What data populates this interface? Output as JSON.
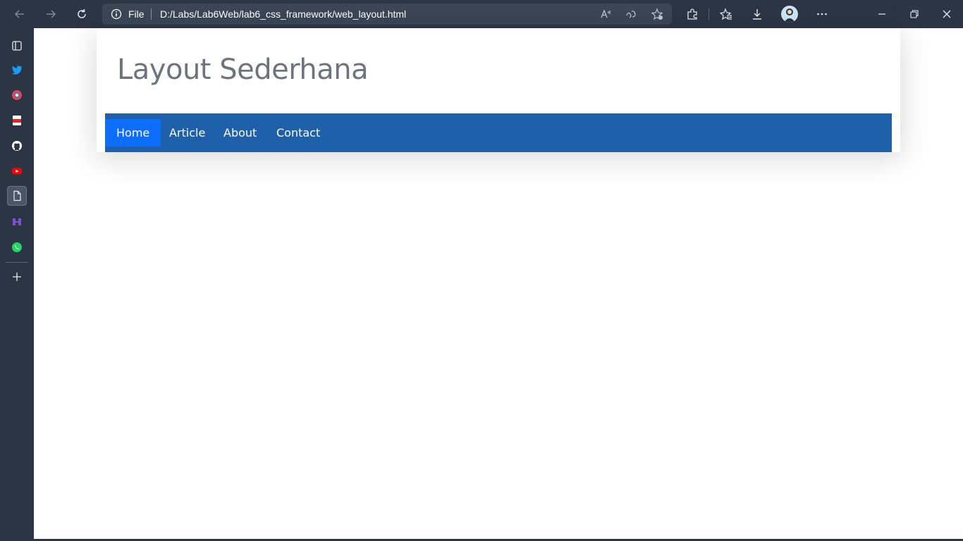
{
  "browser": {
    "address": {
      "scheme_label": "File",
      "url": "D:/Labs/Lab6Web/lab6_css_framework/web_layout.html"
    },
    "icons": {
      "back": "arrow-left-icon",
      "forward": "arrow-right-icon",
      "refresh": "refresh-icon",
      "info": "info-icon",
      "read_aloud": "read-aloud-icon",
      "translate": "translate-icon",
      "favorite_add": "star-add-icon",
      "extensions": "puzzle-icon",
      "favorites": "favorites-icon",
      "downloads": "download-icon",
      "profile": "avatar",
      "more": "more-icon",
      "minimize": "minimize-icon",
      "restore": "restore-icon",
      "close": "close-icon"
    }
  },
  "sidebar": {
    "items": [
      {
        "name": "tab-actions-icon"
      },
      {
        "name": "twitter-icon",
        "color": "#1d9bf0"
      },
      {
        "name": "chrome-ext-icon",
        "color": "#e8453c"
      },
      {
        "name": "pdf-icon",
        "color": "#e02424"
      },
      {
        "name": "github-icon"
      },
      {
        "name": "youtube-icon",
        "color": "#ff0000"
      },
      {
        "name": "document-icon"
      },
      {
        "name": "app-icon",
        "color": "#7b4fd6"
      },
      {
        "name": "whatsapp-icon",
        "color": "#25d366"
      },
      {
        "name": "add-icon"
      }
    ]
  },
  "site": {
    "title": "Layout Sederhana",
    "nav": [
      {
        "label": "Home",
        "active": true
      },
      {
        "label": "Article"
      },
      {
        "label": "About"
      },
      {
        "label": "Contact"
      }
    ],
    "colors": {
      "navbar": "#1f60ab",
      "active": "#0d6efd",
      "title": "#6c757d"
    }
  }
}
